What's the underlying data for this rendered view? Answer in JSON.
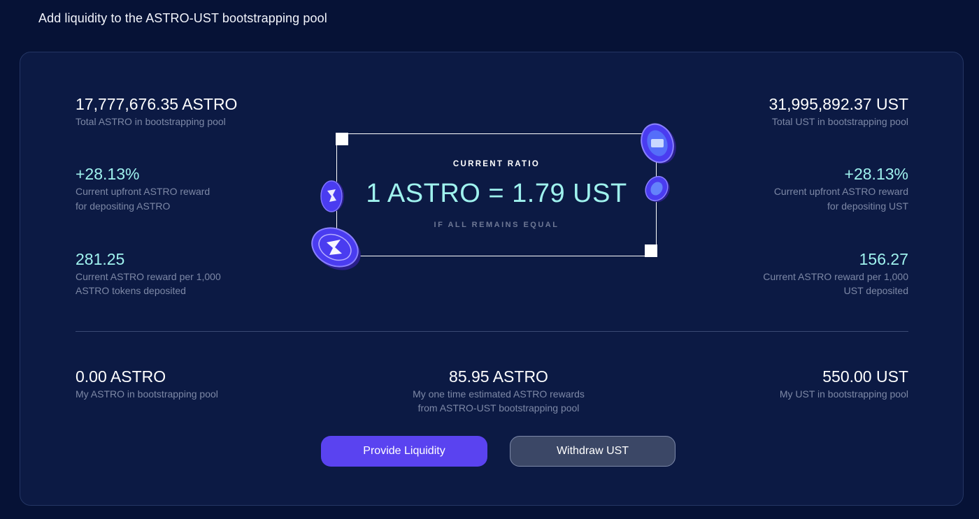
{
  "page": {
    "title": "Add liquidity to the ASTRO-UST bootstrapping pool"
  },
  "left": {
    "total": {
      "value": "17,777,676.35 ASTRO",
      "label": "Total ASTRO in bootstrapping pool"
    },
    "reward": {
      "value": "+28.13%",
      "label1": "Current upfront ASTRO reward",
      "label2": "for depositing ASTRO"
    },
    "per_thousand": {
      "value": "281.25",
      "label1": "Current ASTRO reward per 1,000",
      "label2": "ASTRO tokens deposited"
    }
  },
  "right": {
    "total": {
      "value": "31,995,892.37 UST",
      "label": "Total UST in bootstrapping pool"
    },
    "reward": {
      "value": "+28.13%",
      "label1": "Current upfront ASTRO reward",
      "label2": "for depositing UST"
    },
    "per_thousand": {
      "value": "156.27",
      "label1": "Current ASTRO reward per 1,000",
      "label2": "UST deposited"
    }
  },
  "ratio": {
    "label": "CURRENT RATIO",
    "value": "1 ASTRO = 1.79 UST",
    "note": "IF ALL REMAINS EQUAL"
  },
  "mine": {
    "astro": {
      "value": "0.00 ASTRO",
      "label": "My ASTRO in bootstrapping pool"
    },
    "rewards": {
      "value": "85.95 ASTRO",
      "label1": "My one time estimated ASTRO rewards",
      "label2": "from ASTRO-UST bootstrapping pool"
    },
    "ust": {
      "value": "550.00 UST",
      "label": "My UST in bootstrapping pool"
    }
  },
  "buttons": {
    "provide": "Provide Liquidity",
    "withdraw": "Withdraw UST"
  },
  "icons": [
    "astro-coin-icon",
    "ust-coin-icon"
  ],
  "colors": {
    "accent": "#9ff2ee",
    "primary_button": "#5a43f0",
    "panel": "#0c1a44",
    "background": "#061236"
  }
}
